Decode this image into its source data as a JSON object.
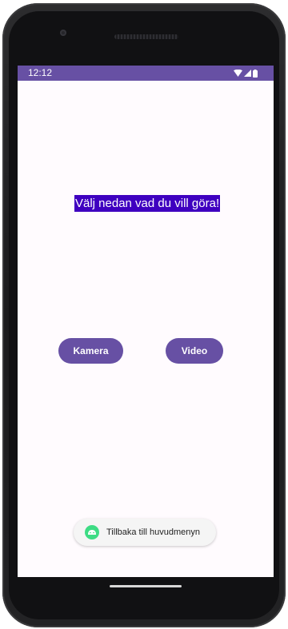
{
  "status_bar": {
    "time": "12:12",
    "icons": [
      "wifi-icon",
      "signal-icon",
      "battery-icon"
    ]
  },
  "main": {
    "heading": "Välj nedan vad du vill göra!",
    "buttons": {
      "kamera": "Kamera",
      "video": "Video"
    }
  },
  "toast": {
    "message": "Tillbaka till huvudmenyn",
    "icon": "android-icon"
  },
  "colors": {
    "primary": "#6750a4",
    "heading_highlight": "#3f00c0",
    "background": "#fffbfe"
  }
}
